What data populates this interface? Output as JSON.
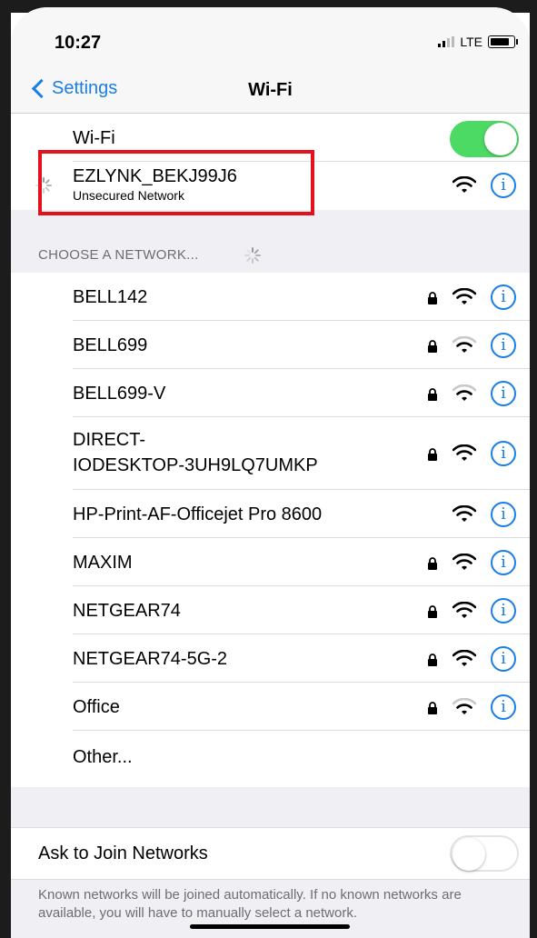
{
  "status": {
    "time": "10:27",
    "carrier": "LTE"
  },
  "nav": {
    "back_label": "Settings",
    "title": "Wi-Fi"
  },
  "wifi_toggle": {
    "label": "Wi-Fi",
    "on": true
  },
  "current": {
    "name": "EZLYNK_BEKJ99J6",
    "subtitle": "Unsecured Network"
  },
  "choose_header": "CHOOSE A NETWORK...",
  "networks": [
    {
      "name": "BELL142",
      "locked": true
    },
    {
      "name": "BELL699",
      "locked": true
    },
    {
      "name": "BELL699-V",
      "locked": true
    },
    {
      "name_line1": "DIRECT-",
      "name_line2": "IODESKTOP-3UH9LQ7UMKP",
      "locked": true
    },
    {
      "name": "HP-Print-AF-Officejet Pro 8600",
      "locked": false
    },
    {
      "name": "MAXIM",
      "locked": true
    },
    {
      "name": "NETGEAR74",
      "locked": true
    },
    {
      "name": "NETGEAR74-5G-2",
      "locked": true
    },
    {
      "name": "Office",
      "locked": true
    }
  ],
  "other_label": "Other...",
  "ask_to_join": {
    "label": "Ask to Join Networks",
    "on": false
  },
  "footer": "Known networks will be joined automatically. If no known networks are available, you will have to manually select a network.",
  "info_glyph": "i",
  "colors": {
    "accent": "#1a7ee6",
    "toggle_on": "#4cd964",
    "highlight": "#e3111b"
  }
}
